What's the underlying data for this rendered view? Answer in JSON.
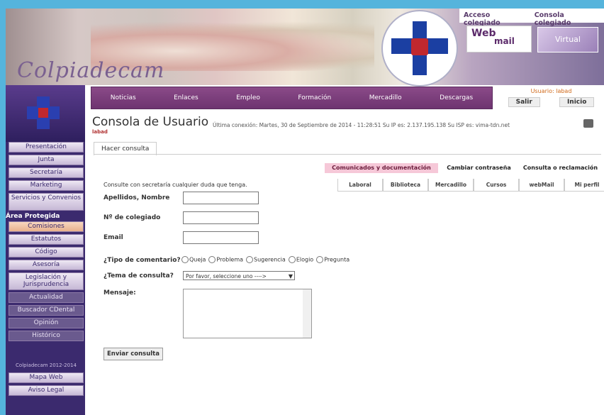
{
  "site": {
    "logo_text": "Colpiadecam"
  },
  "toplinks": [
    "Acceso colegiado",
    "Consola colegiado"
  ],
  "webmail": {
    "a": "Web",
    "b": "mail"
  },
  "virtual": "Virtual",
  "nav": [
    "Noticias",
    "Enlaces",
    "Empleo",
    "Formación",
    "Mercadillo",
    "Descargas"
  ],
  "user": {
    "line": "Usuario: labad",
    "exit": "Salir",
    "home": "Inicio"
  },
  "sidebar": {
    "items": [
      "Presentación",
      "Junta",
      "Secretaría",
      "Marketing",
      "Servicios y Convenios"
    ],
    "section": "Área Protegida",
    "protected": [
      "Comisiones",
      "Estatutos",
      "Código",
      "Asesoría",
      "Legislación y Jurisprudencia",
      "Actualidad",
      "Buscador CDental",
      "Opinión",
      "Histórico"
    ],
    "small": "Colpiadecam 2012-2014",
    "footer": [
      "Mapa Web",
      "Aviso Legal"
    ]
  },
  "content": {
    "title": "Consola de Usuario",
    "sub": "labad",
    "info": "Última conexión: Martes, 30 de Septiembre de 2014 - 11:28:51    Su IP es: 2.137.195.138    Su ISP es: vima-tdn.net",
    "tab": "Hacer consulta",
    "intro": "Consulte con secretaría cualquier duda que tenga.",
    "labels": {
      "name": "Apellidos, Nombre",
      "num": "Nº de colegiado",
      "email": "Email",
      "type": "¿Tipo de comentario?",
      "topic": "¿Tema de consulta?",
      "msg": "Mensaje:"
    },
    "radio": [
      "Queja",
      "Problema",
      "Sugerencia",
      "Elogio",
      "Pregunta"
    ],
    "select": "Por favor, seleccione uno ---->",
    "send": "Enviar consulta"
  },
  "righttabs": [
    "Comunicados y documentación",
    "Cambiar contraseña",
    "Consulta o reclamación"
  ],
  "subtabs": [
    "Laboral",
    "Biblioteca",
    "Mercadillo",
    "Cursos",
    "webMail",
    "Mi perfil"
  ]
}
